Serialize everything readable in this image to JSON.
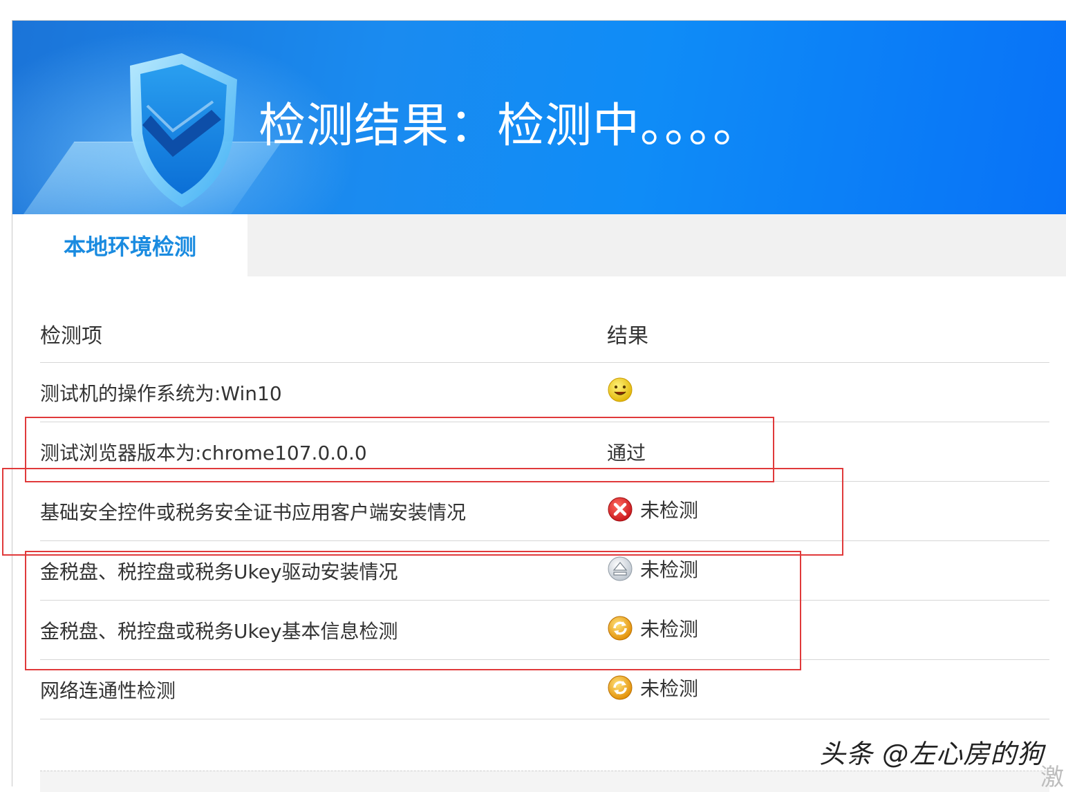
{
  "banner": {
    "title": "检测结果：检测中。。。。"
  },
  "tabs": [
    {
      "label": "本地环境检测",
      "active": true
    }
  ],
  "table": {
    "headers": [
      "检测项",
      "结果"
    ],
    "rows": [
      {
        "item": "测试机的操作系统为:Win10",
        "icon": "smiley-icon",
        "result": ""
      },
      {
        "item": "测试浏览器版本为:chrome107.0.0.0",
        "icon": "",
        "result": "通过"
      },
      {
        "item": "基础安全控件或税务安全证书应用客户端安装情况",
        "icon": "error-x-icon",
        "result": "未检测"
      },
      {
        "item": "金税盘、税控盘或税务Ukey驱动安装情况",
        "icon": "eject-icon",
        "result": "未检测"
      },
      {
        "item": "金税盘、税控盘或税务Ukey基本信息检测",
        "icon": "refresh-icon",
        "result": "未检测"
      },
      {
        "item": "网络连通性检测",
        "icon": "refresh-icon",
        "result": "未检测"
      }
    ]
  },
  "watermark": "头条 @左心房的狗",
  "corner_text": "激",
  "colors": {
    "banner_blue": "#0f8cf7",
    "tab_active_text": "#1a8be0",
    "highlight_red": "#e0393a"
  }
}
